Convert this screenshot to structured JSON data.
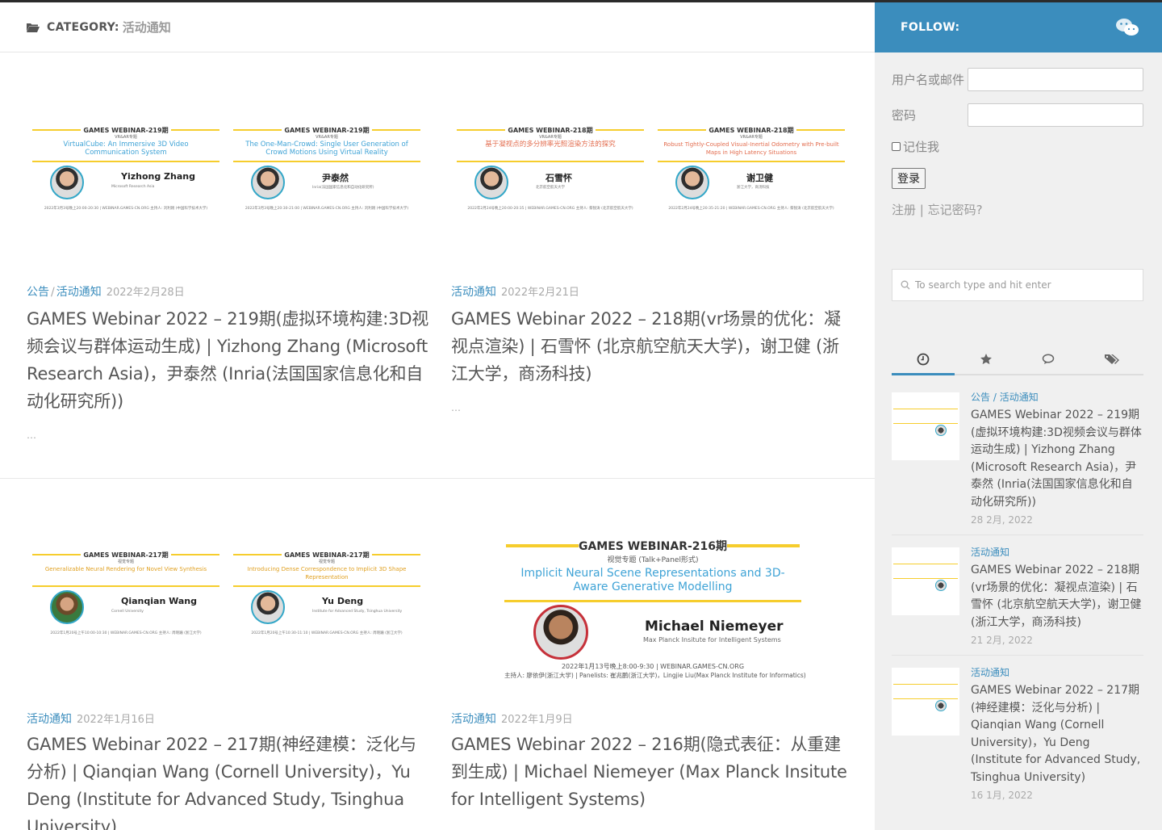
{
  "category": {
    "label": "CATEGORY:",
    "name": "活动通知"
  },
  "posts": [
    {
      "cat1": "公告",
      "cat2": "活动通知",
      "date": "2022年2月28日",
      "title": "GAMES Webinar 2022 – 219期(虚拟环境构建:3D视频会议与群体运动生成) | Yizhong Zhang (Microsoft Research Asia)，尹泰然 (Inria(法国国家信息化和自动化研究所))",
      "excerpt": "…",
      "posters": [
        {
          "title": "GAMES WEBINAR-219期",
          "sub": "VR&AR专题",
          "topic": "VirtualCube: An Immersive 3D Video Communication System",
          "name": "Yizhong Zhang",
          "aff": "Microsoft Research Asia",
          "foot": "2022年3月3号晚上20:00-20:30 | WEBINAR.GAMES-CN.ORG 主持人: 刘利刚 (中国科学技术大学)"
        },
        {
          "title": "GAMES WEBINAR-219期",
          "sub": "VR&AR专题",
          "topic": "The One-Man-Crowd: Single User Generation of Crowd Motions Using Virtual Reality",
          "name": "尹泰然",
          "aff": "Inria(法国国家信息化和自动化研究所)",
          "foot": "2022年3月3号晚上20:30-21:00 | WEBINAR.GAMES-CN.ORG 主持人: 刘利刚 (中国科学技术大学)"
        }
      ]
    },
    {
      "cat1": "活动通知",
      "date": "2022年2月21日",
      "title": "GAMES Webinar 2022 – 218期(vr场景的优化：凝视点渲染) | 石雪怀 (北京航空航天大学)，谢卫健 (浙江大学，商汤科技)",
      "excerpt": "…",
      "posters": [
        {
          "title": "GAMES WEBINAR-218期",
          "sub": "VR&AR专题",
          "topic": "基于凝视点的多分辨率光照渲染方法的探究",
          "name": "石雪怀",
          "aff": "北京航空航天大学",
          "foot": "2022年2月24号晚上20:00-20:35 | WEBINAR.GAMES-CN.ORG 主持人: 蔡锐涛 (北京航空航天大学)"
        },
        {
          "title": "GAMES WEBINAR-218期",
          "sub": "VR&AR专题",
          "topic": "Robust Tightly-Coupled Visual-Inertial Odometry with Pre-built Maps in High Latency Situations",
          "name": "谢卫健",
          "aff": "浙江大学，商汤科技",
          "foot": "2022年2月24号晚上20:35-21:20 | WEBINAR.GAMES-CN.ORG 主持人: 蔡锐涛 (北京航空航天大学)"
        }
      ]
    },
    {
      "cat1": "活动通知",
      "date": "2022年1月16日",
      "title": "GAMES Webinar 2022 – 217期(神经建模：泛化与分析) | Qianqian Wang (Cornell University)，Yu Deng (Institute for Advanced Study, Tsinghua University)",
      "posters": [
        {
          "title": "GAMES WEBINAR-217期",
          "sub": "视觉专题",
          "topic": "Generalizable Neural Rendering for Novel View Synthesis",
          "name": "Qianqian Wang",
          "aff": "Cornell University",
          "foot": "2022年1月20号上午10:00-10:30 | WEBINAR.GAMES-CN.ORG 主持人: 周晓巍 (浙江大学)"
        },
        {
          "title": "GAMES WEBINAR-217期",
          "sub": "视觉专题",
          "topic": "Introducing Dense Correspondence to Implicit 3D Shape Representation",
          "name": "Yu Deng",
          "aff": "Institute for Advanced Study, Tsinghua University",
          "foot": "2022年1月20号上午10:30-11:10 | WEBINAR.GAMES-CN.ORG 主持人: 周晓巍 (浙江大学)"
        }
      ]
    },
    {
      "cat1": "活动通知",
      "date": "2022年1月9日",
      "title": "GAMES Webinar 2022 – 216期(隐式表征：从重建到生成) | Michael Niemeyer (Max Planck Insitute for Intelligent Systems)",
      "poster": {
        "title": "GAMES WEBINAR-216期",
        "sub": "视觉专题 (Talk+Panel形式)",
        "topic": "Implicit Neural Scene Representations and 3D-Aware Generative Modelling",
        "name": "Michael Niemeyer",
        "aff": "Max Planck Insitute for Intelligent Systems",
        "foot1": "2022年1月13号晚上8:00-9:30 | WEBINAR.GAMES-CN.ORG",
        "foot2": "主持人: 廖依伊(浙江大学) | Panelists: 崔兆鹏(浙江大学)，Lingjie Liu(Max Planck Institute for Informatics)"
      }
    }
  ],
  "sidebar": {
    "follow_label": "FOLLOW:",
    "login": {
      "user_label": "用户名或邮件",
      "pass_label": "密码",
      "remember": "记住我",
      "button": "登录",
      "register": "注册",
      "sep": "|",
      "forgot": "忘记密码?"
    },
    "search_placeholder": "To search type and hit enter",
    "recent": [
      {
        "cat1": "公告",
        "cat2": "活动通知",
        "title": "GAMES Webinar 2022 – 219期(虚拟环境构建:3D视频会议与群体运动生成) | Yizhong Zhang (Microsoft Research Asia)，尹泰然 (Inria(法国国家信息化和自动化研究所))",
        "date": "28 2月, 2022"
      },
      {
        "cat1": "活动通知",
        "title": "GAMES Webinar 2022 – 218期(vr场景的优化：凝视点渲染) | 石雪怀 (北京航空航天大学)，谢卫健 (浙江大学，商汤科技)",
        "date": "21 2月, 2022"
      },
      {
        "cat1": "活动通知",
        "title": "GAMES Webinar 2022 – 217期(神经建模：泛化与分析) | Qianqian Wang (Cornell University)，Yu Deng (Institute for Advanced Study, Tsinghua University)",
        "date": "16 1月, 2022"
      }
    ]
  },
  "colors": {
    "accent": "#3b8dbd",
    "poster_yellow": "#f6cd2d",
    "poster_blue": "#3fa3d6"
  }
}
